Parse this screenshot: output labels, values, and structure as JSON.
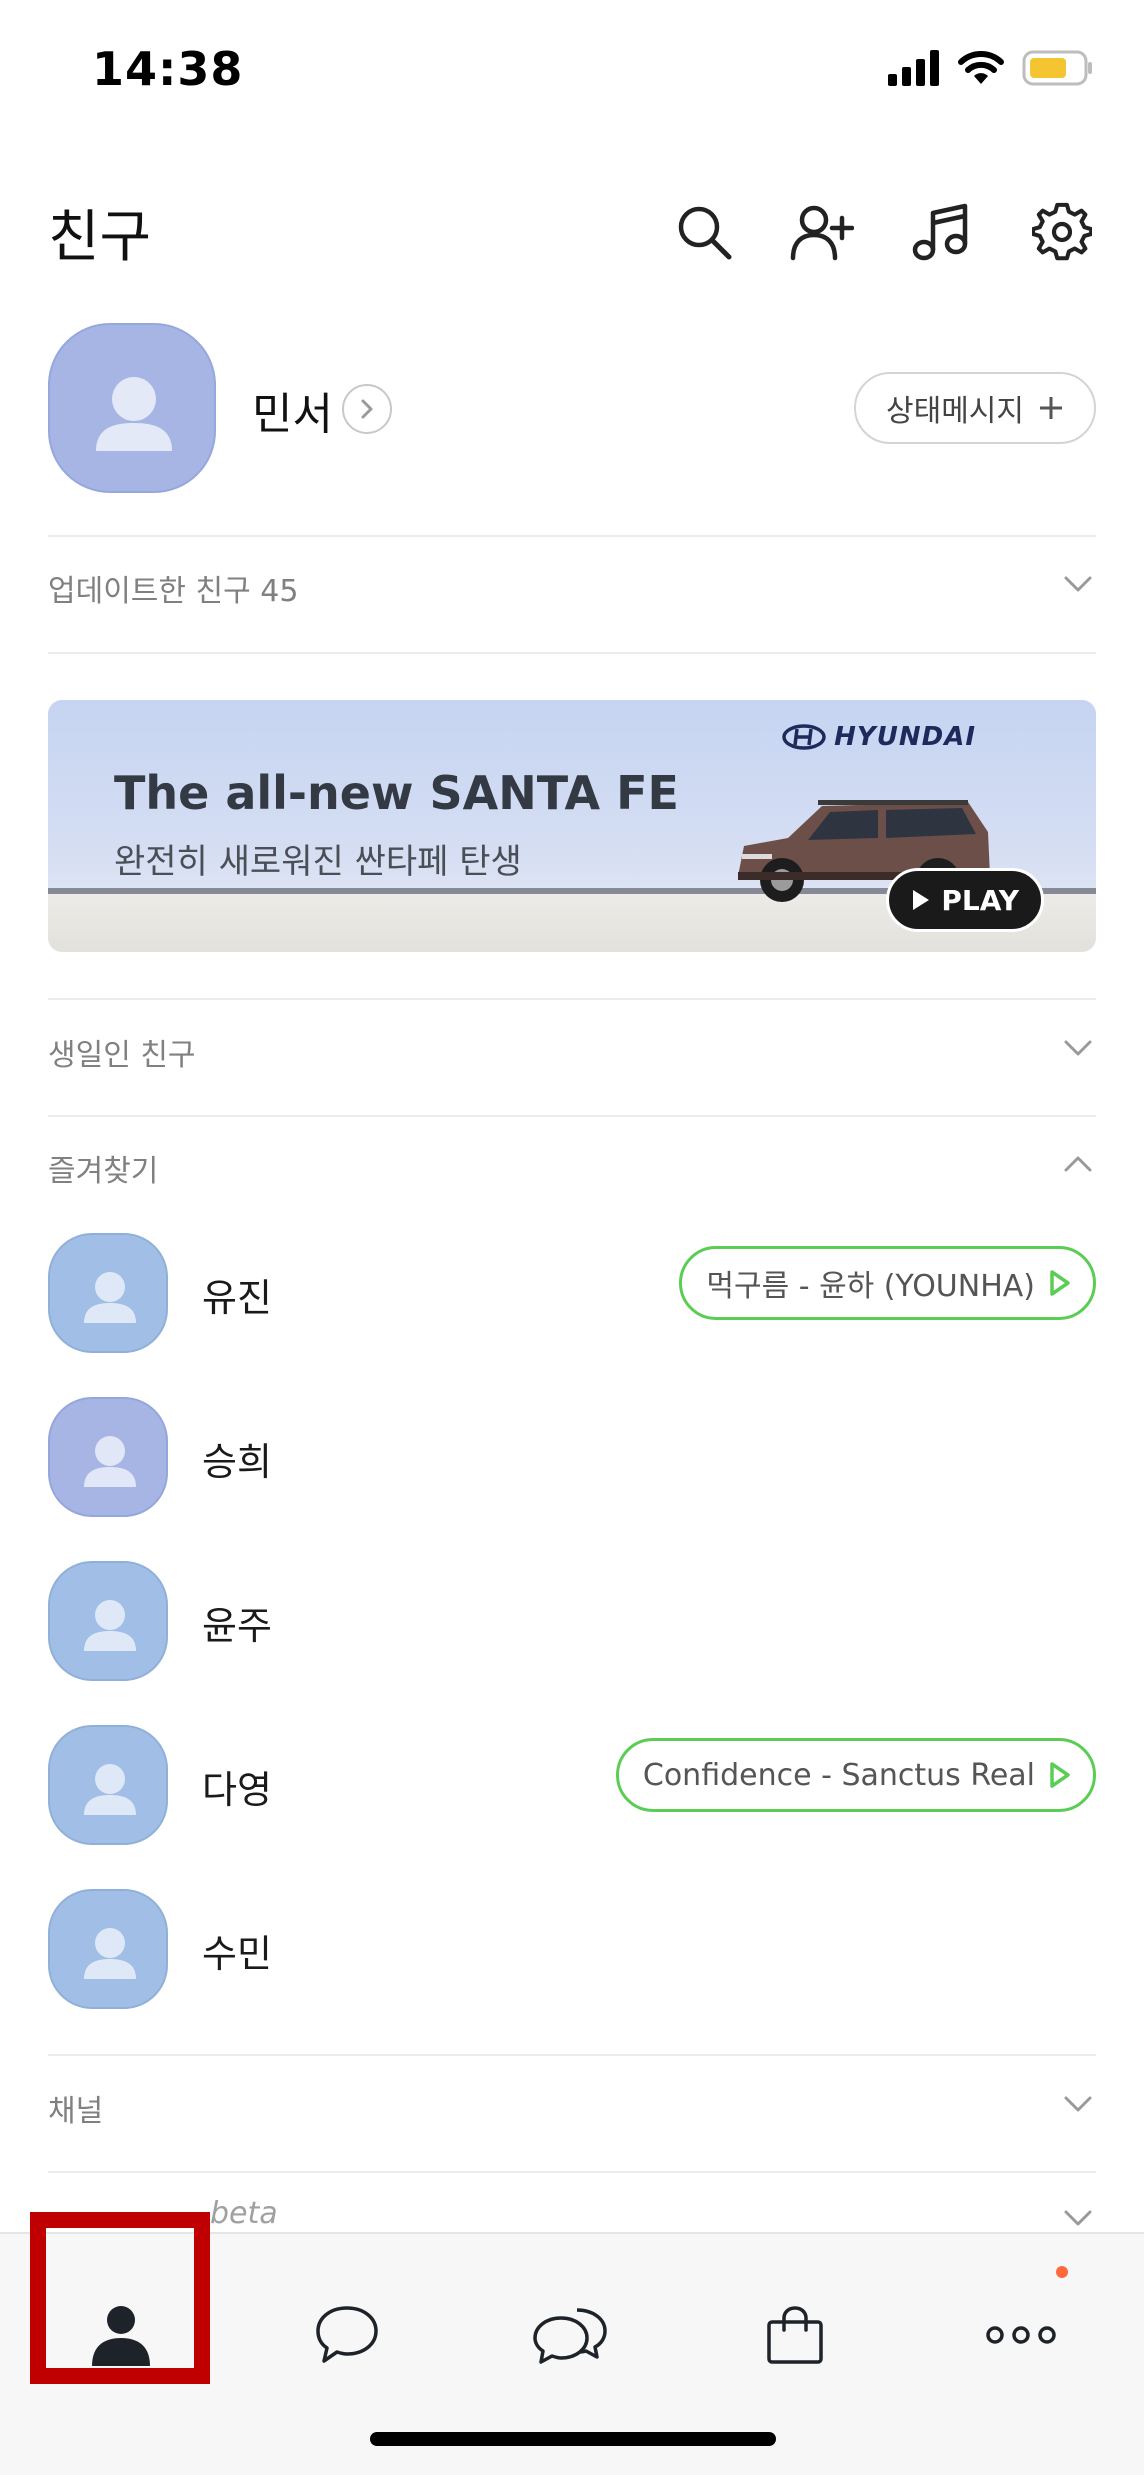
{
  "status_bar": {
    "time": "14:38"
  },
  "header": {
    "title": "친구"
  },
  "profile": {
    "name": "민서",
    "status_button_label": "상태메시지"
  },
  "sections": {
    "updated_friends": "업데이트한 친구 45",
    "birthday": "생일인 친구",
    "favorites": "즐겨찾기",
    "channels": "채널",
    "next_section_partial": "beta"
  },
  "banner": {
    "brand": "HYUNDAI",
    "headline": "The all-new SANTA FE",
    "subline": "완전히 새로워진 싼타페 탄생",
    "play_label": "PLAY"
  },
  "favorites": [
    {
      "name": "유진",
      "music": "먹구름 - 윤하 (YOUNHA)"
    },
    {
      "name": "승희",
      "music": ""
    },
    {
      "name": "윤주",
      "music": ""
    },
    {
      "name": "다영",
      "music": "Confidence - Sanctus Real"
    },
    {
      "name": "수민",
      "music": ""
    }
  ],
  "tabbar": {
    "tabs": [
      {
        "icon": "person-icon",
        "selected": true
      },
      {
        "icon": "chat-bubble-icon",
        "selected": false
      },
      {
        "icon": "open-chat-icon",
        "selected": false
      },
      {
        "icon": "shopping-bag-icon",
        "selected": false
      },
      {
        "icon": "more-icon",
        "selected": false,
        "badge": true
      }
    ]
  },
  "colors": {
    "music_border": "#5bcd55",
    "highlight": "#c00000",
    "avatar_blue": "#a1bfe6",
    "avatar_purple": "#a6b5e4",
    "badge": "#ff6a3d"
  }
}
